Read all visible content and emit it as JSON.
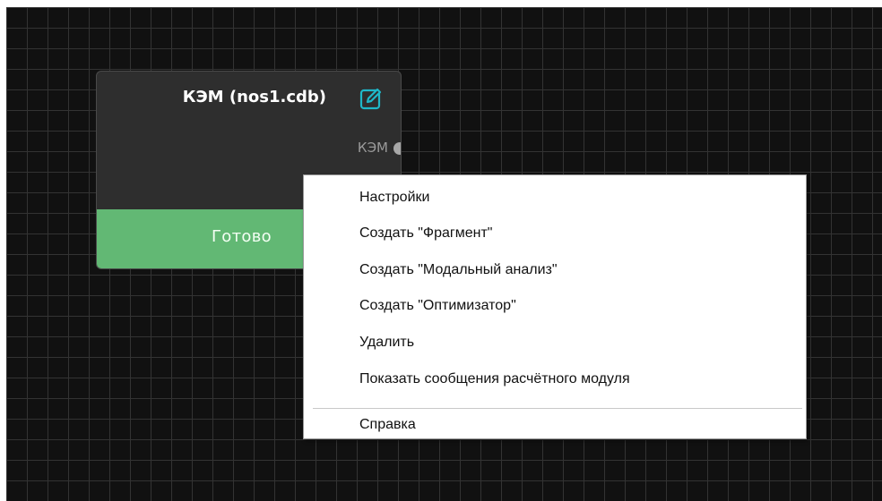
{
  "node": {
    "title": "КЭМ (nos1.cdb)",
    "port_label": "КЭМ",
    "status": "Готово",
    "edit_icon": "edit-icon",
    "colors": {
      "status_bar": "#62b874",
      "edit_icon": "#1fb8c9",
      "body": "#2e2e2e"
    }
  },
  "context_menu": {
    "items": [
      {
        "label": "Настройки"
      },
      {
        "label": "Создать \"Фрагмент\""
      },
      {
        "label": "Создать \"Модальный анализ\""
      },
      {
        "label": "Создать \"Оптимизатор\""
      },
      {
        "label": "Удалить"
      },
      {
        "label": "Показать сообщения расчётного модуля"
      }
    ],
    "footer_items": [
      {
        "label": "Справка"
      }
    ]
  }
}
